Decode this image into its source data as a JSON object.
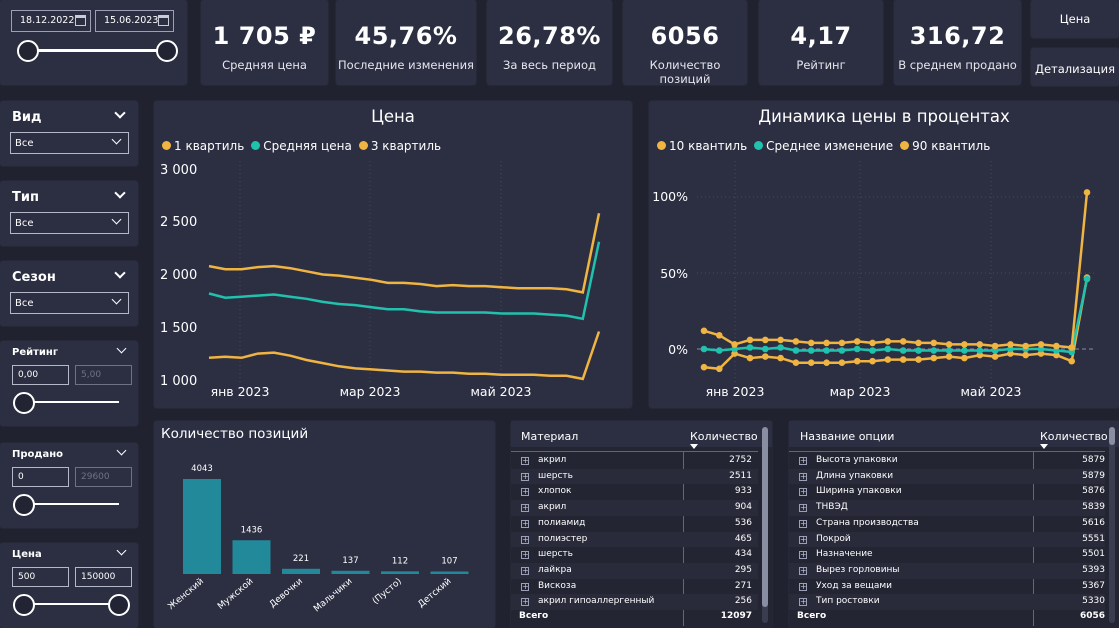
{
  "filters": {
    "date_from": "18.12.2022",
    "date_to": "15.06.2023"
  },
  "kpis": [
    {
      "value": "1 705 ₽",
      "label": "Средняя цена"
    },
    {
      "value": "45,76%",
      "label": "Последние изменения"
    },
    {
      "value": "26,78%",
      "label": "За весь период"
    },
    {
      "value": "6056",
      "label": "Количество позиций"
    },
    {
      "value": "4,17",
      "label": "Рейтинг"
    },
    {
      "value": "316,72",
      "label": "В среднем продано"
    }
  ],
  "nav": {
    "price": "Цена",
    "details": "Детализация"
  },
  "slicers": {
    "vid": {
      "title": "Вид",
      "value": "Все"
    },
    "tip": {
      "title": "Тип",
      "value": "Все"
    },
    "sezon": {
      "title": "Сезон",
      "value": "Все"
    },
    "rating": {
      "title": "Рейтинг",
      "min": "0,00",
      "max": "5,00"
    },
    "sold": {
      "title": "Продано",
      "min": "0",
      "max": "29600"
    },
    "price": {
      "title": "Цена",
      "min": "500",
      "max": "150000"
    }
  },
  "colors": {
    "quartile": "#f0b442",
    "mean": "#20c2ad",
    "bar": "#22899a",
    "bg": "#20222f",
    "card": "#2c2f42"
  },
  "price_chart": {
    "title": "Цена",
    "legend": [
      "1 квартиль",
      "Средняя цена",
      "3 квартиль"
    ],
    "y_ticks": [
      "3 000",
      "2 500",
      "2 000",
      "1 500",
      "1 000"
    ],
    "x_ticks": [
      "янв 2023",
      "мар 2023",
      "май 2023"
    ]
  },
  "dyn_chart": {
    "title": "Динамика цены в процентах",
    "legend": [
      "10 квантиль",
      "Среднее изменение",
      "90 квантиль"
    ],
    "y_ticks": [
      "100%",
      "50%",
      "0%"
    ],
    "x_ticks": [
      "янв 2023",
      "мар 2023",
      "май 2023"
    ]
  },
  "chart_data": [
    {
      "type": "line",
      "title": "Цена",
      "ylim": [
        1000,
        3000
      ],
      "series": [
        {
          "name": "1 квартиль",
          "values": [
            1210,
            1220,
            1210,
            1250,
            1260,
            1230,
            1190,
            1160,
            1130,
            1110,
            1100,
            1090,
            1080,
            1080,
            1070,
            1070,
            1060,
            1060,
            1050,
            1050,
            1050,
            1040,
            1040,
            1010,
            1460
          ]
        },
        {
          "name": "Средняя цена",
          "values": [
            1820,
            1780,
            1790,
            1800,
            1810,
            1790,
            1770,
            1740,
            1720,
            1710,
            1690,
            1670,
            1670,
            1650,
            1640,
            1640,
            1640,
            1640,
            1630,
            1630,
            1630,
            1620,
            1610,
            1580,
            2310
          ]
        },
        {
          "name": "3 квартиль",
          "values": [
            2080,
            2050,
            2050,
            2070,
            2080,
            2060,
            2030,
            2000,
            1990,
            1970,
            1950,
            1920,
            1920,
            1910,
            1890,
            1900,
            1890,
            1890,
            1880,
            1870,
            1870,
            1870,
            1860,
            1830,
            2580
          ]
        }
      ]
    },
    {
      "type": "line",
      "title": "Динамика цены в процентах",
      "ylim": [
        -15,
        110
      ],
      "series": [
        {
          "name": "10 квантиль",
          "values": [
            -12,
            -13,
            -3,
            -6,
            -5,
            -6,
            -9,
            -9,
            -9,
            -9,
            -8,
            -8,
            -7,
            -7,
            -7,
            -6,
            -5,
            -6,
            -4,
            -5,
            -3,
            -4,
            -3,
            -4,
            -8,
            47
          ]
        },
        {
          "name": "Среднее изменение",
          "values": [
            0,
            -1,
            0,
            1,
            0,
            1,
            -1,
            -1,
            -1,
            -1,
            0,
            -1,
            0,
            -1,
            -1,
            -1,
            -1,
            -1,
            -1,
            -1,
            0,
            0,
            0,
            -1,
            -2,
            46
          ]
        },
        {
          "name": "90 квантиль",
          "values": [
            12,
            9,
            3,
            6,
            6,
            6,
            5,
            4,
            4,
            4,
            5,
            4,
            5,
            5,
            4,
            4,
            3,
            3,
            3,
            2,
            3,
            2,
            3,
            2,
            1,
            103
          ]
        }
      ]
    },
    {
      "type": "bar",
      "title": "Количество позиций",
      "categories": [
        "Женский",
        "Мужской",
        "Девочки",
        "Мальчики",
        "(Пусто)",
        "Детский"
      ],
      "values": [
        4043,
        1436,
        221,
        137,
        112,
        107
      ]
    }
  ],
  "bar_chart": {
    "title": "Количество позиций"
  },
  "material_table": {
    "headers": [
      "Материал",
      "Количество"
    ],
    "rows": [
      {
        "name": "акрил",
        "value": "2752"
      },
      {
        "name": "шерсть",
        "value": "2511"
      },
      {
        "name": "хлопок",
        "value": "933"
      },
      {
        "name": "акрил",
        "value": "904"
      },
      {
        "name": "полиамид",
        "value": "536"
      },
      {
        "name": "полиэстер",
        "value": "465"
      },
      {
        "name": "шерсть",
        "value": "434"
      },
      {
        "name": "лайкра",
        "value": "295"
      },
      {
        "name": "Вискоза",
        "value": "271"
      },
      {
        "name": "акрил гипоаллергенный",
        "value": "256"
      }
    ],
    "total_label": "Всего",
    "total_value": "12097"
  },
  "option_table": {
    "headers": [
      "Название опции",
      "Количество"
    ],
    "rows": [
      {
        "name": "Высота упаковки",
        "value": "5879"
      },
      {
        "name": "Длина упаковки",
        "value": "5879"
      },
      {
        "name": "Ширина упаковки",
        "value": "5876"
      },
      {
        "name": "ТНВЭД",
        "value": "5839"
      },
      {
        "name": "Страна производства",
        "value": "5616"
      },
      {
        "name": "Покрой",
        "value": "5551"
      },
      {
        "name": "Назначение",
        "value": "5501"
      },
      {
        "name": "Вырез горловины",
        "value": "5393"
      },
      {
        "name": "Уход за вещами",
        "value": "5367"
      },
      {
        "name": "Тип ростовки",
        "value": "5330"
      }
    ],
    "total_label": "Всего",
    "total_value": "6056"
  }
}
